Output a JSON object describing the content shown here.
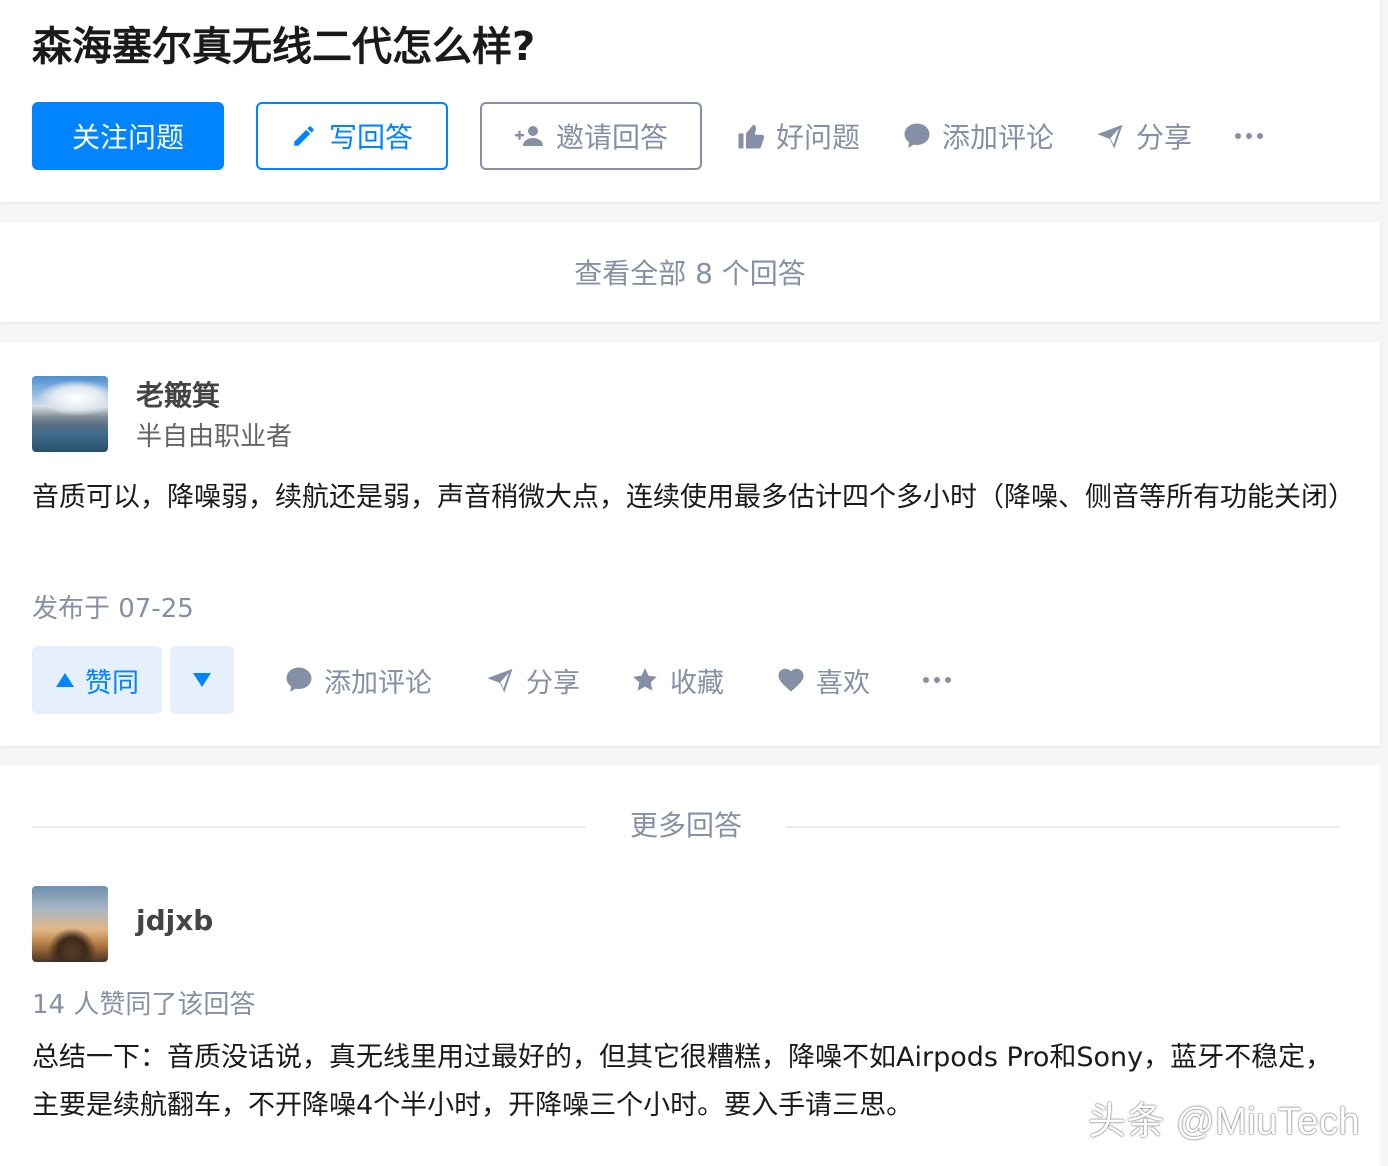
{
  "question": {
    "title": "森海塞尔真无线二代怎么样?",
    "actions": {
      "follow_label": "关注问题",
      "write_label": "写回答",
      "invite_label": "邀请回答",
      "good_question_label": "好问题",
      "comment_label": "添加评论",
      "share_label": "分享",
      "more_label": "···"
    }
  },
  "view_all": {
    "label": "查看全部 8 个回答"
  },
  "answer": {
    "author": {
      "name": "老簸箕",
      "headline": "半自由职业者"
    },
    "content": "音质可以，降噪弱，续航还是弱，声音稍微大点，连续使用最多估计四个多小时（降噪、侧音等所有功能关闭）",
    "published": "发布于 07-25",
    "actions": {
      "upvote_label": "赞同",
      "comment_label": "添加评论",
      "share_label": "分享",
      "collect_label": "收藏",
      "like_label": "喜欢",
      "more_label": "···"
    }
  },
  "more_answers": {
    "label": "更多回答",
    "item": {
      "author": {
        "name": "jdjxb"
      },
      "vote_summary": "14 人赞同了该回答",
      "content": "总结一下：音质没话说，真无线里用过最好的，但其它很糟糕，降噪不如Airpods Pro和Sony，蓝牙不稳定，主要是续航翻车，不开降噪4个半小时，开降噪三个小时。要入手请三思。"
    }
  },
  "watermark": "头条 @MiuTech",
  "colors": {
    "accent": "#0084ff",
    "muted": "#8590a6",
    "upvote_bg": "#e6f0fd"
  },
  "icons": [
    "pencil-icon",
    "add-user-icon",
    "thumbs-up-icon",
    "comment-icon",
    "share-icon",
    "more-icon",
    "triangle-up-icon",
    "triangle-down-icon",
    "star-icon",
    "heart-icon"
  ]
}
